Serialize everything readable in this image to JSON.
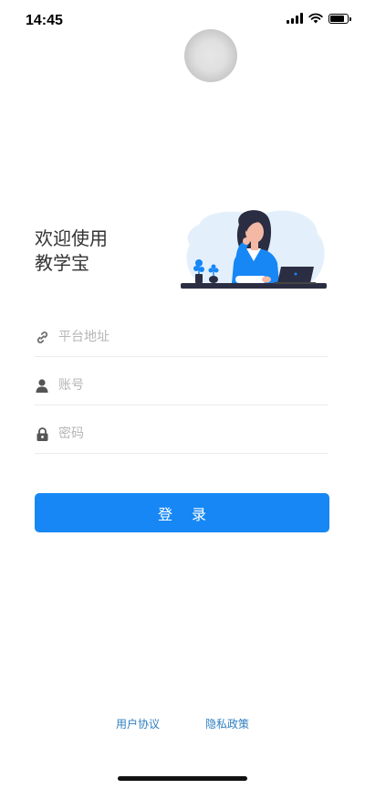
{
  "status_bar": {
    "time": "14:45"
  },
  "welcome": {
    "line1": "欢迎使用",
    "line2": "教学宝"
  },
  "form": {
    "platform_placeholder": "平台地址",
    "account_placeholder": "账号",
    "password_placeholder": "密码",
    "platform_value": "",
    "account_value": "",
    "password_value": ""
  },
  "login_button": "登 录",
  "footer": {
    "user_agreement": "用户协议",
    "privacy_policy": "隐私政策"
  },
  "colors": {
    "primary": "#1787f5",
    "link": "#2f7fc0",
    "placeholder": "#b5b5b5"
  },
  "icons": {
    "platform": "link-icon",
    "account": "user-icon",
    "password": "lock-icon"
  }
}
